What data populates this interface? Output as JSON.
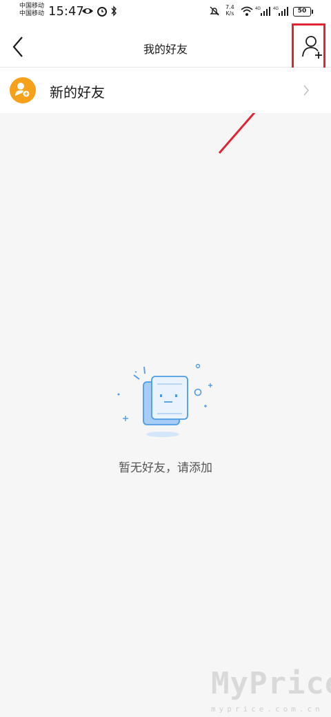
{
  "status_bar": {
    "carrier1": "中国移动",
    "carrier2": "中国移动",
    "time": "15:47",
    "net_speed_value": "7.4",
    "net_speed_unit": "K/s",
    "signal_label": "4G",
    "battery": "50"
  },
  "navbar": {
    "title": "我的好友"
  },
  "new_friends": {
    "label": "新的好友"
  },
  "empty_state": {
    "message": "暂无好友，请添加"
  },
  "watermark": {
    "text": "MyPrice",
    "sub": "myprice.com.cn"
  },
  "colors": {
    "accent_orange": "#f7a11a",
    "highlight_red": "#e02434",
    "illustration_blue": "#4a9be8"
  }
}
